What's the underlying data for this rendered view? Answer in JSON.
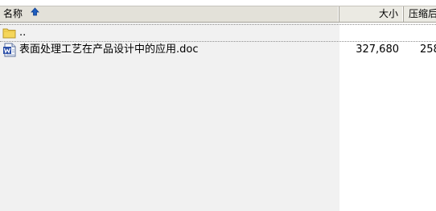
{
  "columns": {
    "name": "名称",
    "size": "大小",
    "compressed": "压缩后"
  },
  "rows": [
    {
      "name": "..",
      "size": "",
      "compressed": "",
      "icon": "folder-icon"
    },
    {
      "name": "表面处理工艺在产品设计中的应用.doc",
      "size": "327,680",
      "compressed": "258",
      "icon": "word-document-icon"
    }
  ],
  "colors": {
    "header_bg": "#ebeae3",
    "sorted_column_bg": "#f1f1f1",
    "sort_arrow": "#1e5dbf",
    "word_icon_blue": "#2b4fa8",
    "folder_yellow": "#f5d65a"
  }
}
